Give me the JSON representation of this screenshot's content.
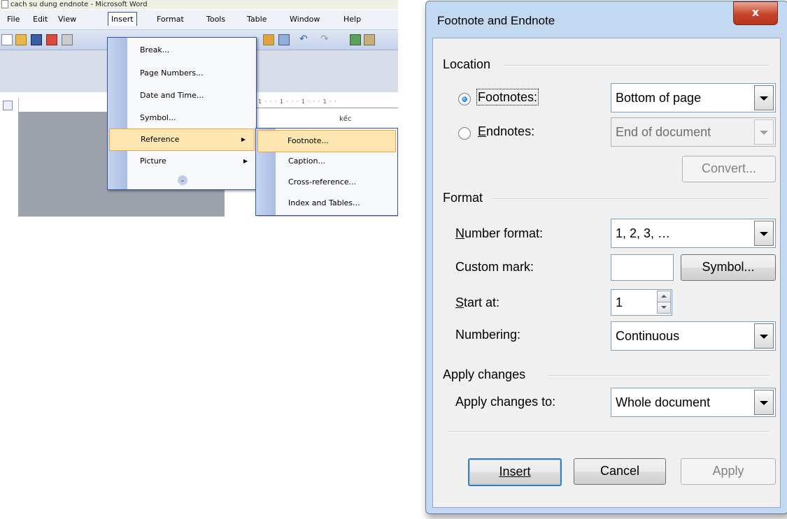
{
  "word": {
    "window_title": "cach su dung endnote - Microsoft Word",
    "menubar": [
      "File",
      "Edit",
      "View",
      "Insert",
      "Format",
      "Tools",
      "Table",
      "Window",
      "Help"
    ],
    "insert_menu": [
      "Break...",
      "Page Numbers...",
      "Date and Time...",
      "Symbol...",
      "Reference",
      "Picture"
    ],
    "reference_submenu": [
      "Footnote...",
      "Caption...",
      "Cross-reference...",
      "Index and Tables..."
    ],
    "doc_text": "kếc"
  },
  "dialog": {
    "title": "Footnote and Endnote",
    "close_glyph": "x",
    "location_group": "Location",
    "footnotes_label": "Footnotes:",
    "footnotes_value": "Bottom of page",
    "endnotes_label": "Endnotes:",
    "endnotes_value": "End of document",
    "convert_button": "Convert...",
    "format_group": "Format",
    "number_format_label": "Number format:",
    "number_format_value": "1, 2, 3, …",
    "custom_mark_label": "Custom mark:",
    "custom_mark_value": "",
    "symbol_button": "Symbol...",
    "start_at_label": "Start at:",
    "start_at_value": "1",
    "numbering_label": "Numbering:",
    "numbering_value": "Continuous",
    "apply_group": "Apply changes",
    "apply_to_label": "Apply changes to:",
    "apply_to_value": "Whole document",
    "insert_button": "Insert",
    "cancel_button": "Cancel",
    "apply_button": "Apply"
  },
  "colors": {
    "dialog_frame": "#c3d9f1",
    "close_red": "#c5442a",
    "menu_highlight": "#fde6b0",
    "menu_border": "#2f55a4"
  }
}
